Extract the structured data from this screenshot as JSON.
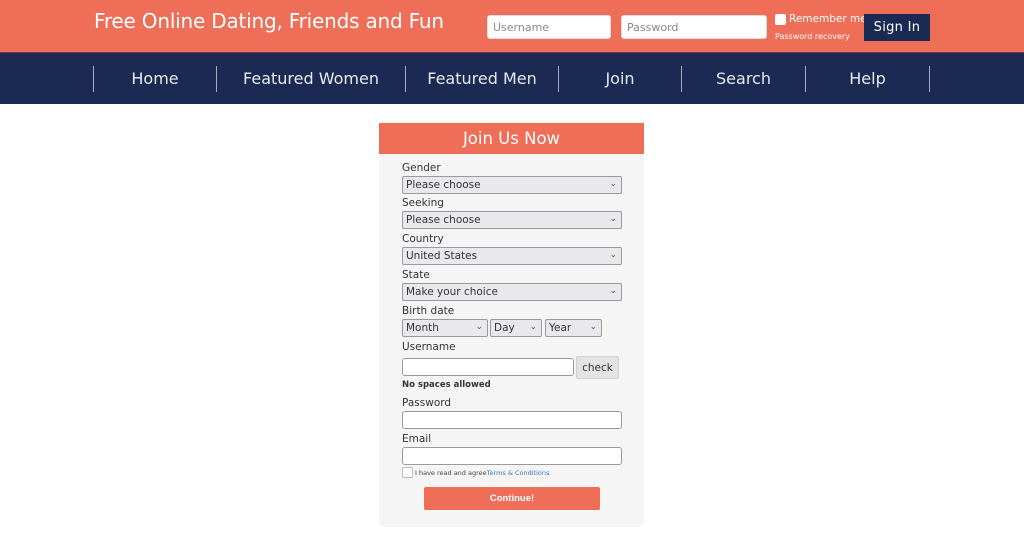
{
  "header": {
    "title": "Free Online Dating, Friends and Fun",
    "login": {
      "username_placeholder": "Username",
      "username_value": "",
      "password_placeholder": "Password",
      "password_value": "",
      "remember_label": "Remember me",
      "remember_checked": false,
      "recovery_link": "Password recovery",
      "signin_label": "Sign In"
    }
  },
  "nav": {
    "items": [
      {
        "label": "Home"
      },
      {
        "label": "Featured Women"
      },
      {
        "label": "Featured Men"
      },
      {
        "label": "Join"
      },
      {
        "label": "Search"
      },
      {
        "label": "Help"
      }
    ]
  },
  "join_form": {
    "title": "Join Us Now",
    "gender": {
      "label": "Gender",
      "selected": "Please choose"
    },
    "seeking": {
      "label": "Seeking",
      "selected": "Please choose"
    },
    "country": {
      "label": "Country",
      "selected": "United States"
    },
    "state": {
      "label": "State",
      "selected": "Make your choice"
    },
    "birth_date": {
      "label": "Birth date",
      "month": "Month",
      "day": "Day",
      "year": "Year"
    },
    "username": {
      "label": "Username",
      "value": "",
      "check_label": "check",
      "hint": "No spaces allowed"
    },
    "password": {
      "label": "Password",
      "value": ""
    },
    "email": {
      "label": "Email",
      "value": ""
    },
    "terms": {
      "text": "I have read and agree",
      "link": "Terms & Conditions",
      "checked": false
    },
    "continue_label": "Continue!"
  },
  "colors": {
    "brand_coral": "#ee6e58",
    "navy": "#1b2a52",
    "link_blue": "#3a78b5"
  },
  "icons": {
    "chevron": "⌄"
  }
}
